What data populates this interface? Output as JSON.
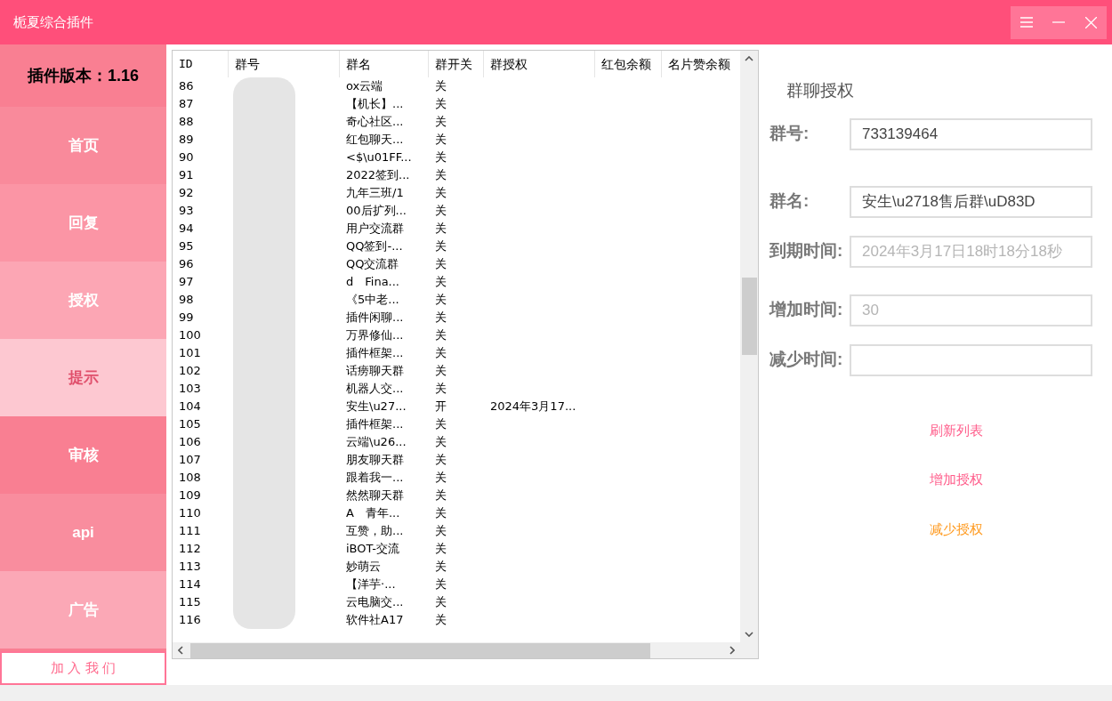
{
  "window": {
    "title": "栀夏综合插件"
  },
  "sidebar": {
    "version": "插件版本：1.16",
    "items": [
      {
        "label": "首页",
        "color": "#f98a9b"
      },
      {
        "label": "回复",
        "color": "#fb95a5"
      },
      {
        "label": "授权",
        "color": "#fca6b4"
      },
      {
        "label": "提示",
        "color": "#fdc8d1"
      },
      {
        "label": "审核",
        "color": "#f97f92"
      },
      {
        "label": "api",
        "color": "#f98d9e"
      },
      {
        "label": "广告",
        "color": "#fba8b6"
      }
    ],
    "join_button": "加 入 我 们"
  },
  "table": {
    "columns": [
      "ID",
      "群号",
      "群名",
      "群开关",
      "群授权",
      "红包余额",
      "名片赞余额"
    ],
    "rows": [
      {
        "id": "86",
        "name": "ox云端",
        "switch": "关"
      },
      {
        "id": "87",
        "name": "【机长】...",
        "switch": "关"
      },
      {
        "id": "88",
        "name": "奇心社区...",
        "switch": "关"
      },
      {
        "id": "89",
        "name": "红包聊天...",
        "switch": "关"
      },
      {
        "id": "90",
        "name": "<$\\u01FF...",
        "switch": "关"
      },
      {
        "id": "91",
        "name": "2022签到...",
        "switch": "关"
      },
      {
        "id": "92",
        "name": "九年三班/1",
        "switch": "关"
      },
      {
        "id": "93",
        "name": "00后扩列...",
        "switch": "关"
      },
      {
        "id": "94",
        "name": "用户交流群",
        "switch": "关"
      },
      {
        "id": "95",
        "name": "QQ签到-...",
        "switch": "关"
      },
      {
        "id": "96",
        "name": "QQ交流群",
        "switch": "关"
      },
      {
        "id": "97",
        "name": "d　Fina...",
        "switch": "关"
      },
      {
        "id": "98",
        "name": "《5中老...",
        "switch": "关"
      },
      {
        "id": "99",
        "name": "插件闲聊...",
        "switch": "关"
      },
      {
        "id": "100",
        "name": "万界修仙...",
        "switch": "关"
      },
      {
        "id": "101",
        "name": "插件框架...",
        "switch": "关"
      },
      {
        "id": "102",
        "name": "话痨聊天群",
        "switch": "关"
      },
      {
        "id": "103",
        "name": "机器人交...",
        "switch": "关"
      },
      {
        "id": "104",
        "name": "安生\\u27...",
        "switch": "开",
        "auth": "2024年3月17..."
      },
      {
        "id": "105",
        "name": "插件框架...",
        "switch": "关"
      },
      {
        "id": "106",
        "name": "云端\\u26...",
        "switch": "关"
      },
      {
        "id": "107",
        "name": "朋友聊天群",
        "switch": "关"
      },
      {
        "id": "108",
        "name": "跟着我一...",
        "switch": "关"
      },
      {
        "id": "109",
        "name": "然然聊天群",
        "switch": "关"
      },
      {
        "id": "110",
        "name": "A　青年...",
        "switch": "关"
      },
      {
        "id": "111",
        "name": "互赞，助...",
        "switch": "关"
      },
      {
        "id": "112",
        "name": "iBOT-交流",
        "switch": "关"
      },
      {
        "id": "113",
        "name": "妙萌云",
        "switch": "关"
      },
      {
        "id": "114",
        "name": "【洋芋·...",
        "switch": "关"
      },
      {
        "id": "115",
        "name": "云电脑交...",
        "switch": "关"
      },
      {
        "id": "116",
        "name": "软件社A17",
        "switch": "关"
      }
    ]
  },
  "panel": {
    "title": "群聊授权",
    "fields": [
      {
        "label": "群号:",
        "value": "733139464",
        "kind": "value"
      },
      {
        "label": "群名:",
        "value": "安生\\u2718售后群\\uD83D",
        "kind": "value"
      },
      {
        "label": "到期时间:",
        "value": "2024年3月17日18时18分18秒",
        "kind": "disabled"
      },
      {
        "label": "增加时间:",
        "value": "30",
        "kind": "disabled"
      },
      {
        "label": "减少时间:",
        "kind": "value"
      }
    ],
    "actions": [
      {
        "label": "刷新列表",
        "color": "#ff5c8a"
      },
      {
        "label": "增加授权",
        "color": "#ff5c8a"
      },
      {
        "label": "减少授权",
        "color": "#ff9a1f"
      }
    ]
  }
}
